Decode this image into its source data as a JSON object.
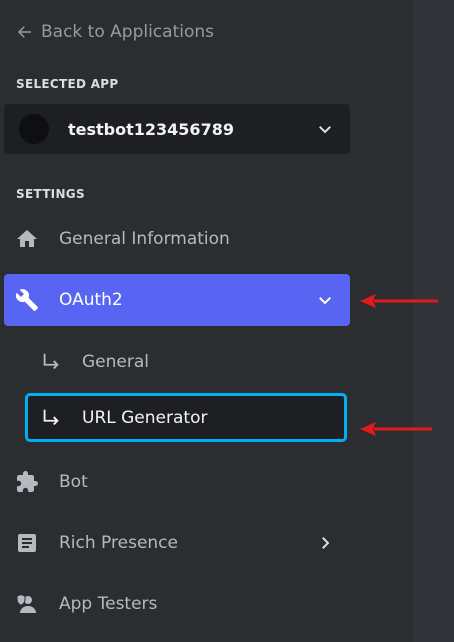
{
  "nav": {
    "back_label": "Back to Applications",
    "selected_app_heading": "SELECTED APP",
    "app_name": "testbot123456789",
    "settings_heading": "SETTINGS",
    "items": [
      {
        "label": "General Information",
        "icon": "home-icon"
      },
      {
        "label": "OAuth2",
        "icon": "wrench-icon",
        "active": true,
        "expanded": true
      },
      {
        "label": "Bot",
        "icon": "puzzle-icon"
      },
      {
        "label": "Rich Presence",
        "icon": "document-icon"
      },
      {
        "label": "App Testers",
        "icon": "user-shield-icon"
      }
    ],
    "oauth_sub_items": [
      {
        "label": "General",
        "icon": "subitem-arrow-icon"
      },
      {
        "label": "URL Generator",
        "icon": "subitem-arrow-icon",
        "highlighted": true
      }
    ]
  },
  "colors": {
    "sidebar_bg": "#2b2d31",
    "active_bg": "#5865f2",
    "highlight_border": "#00b0f4",
    "annotation_arrow": "#e01b1b"
  }
}
